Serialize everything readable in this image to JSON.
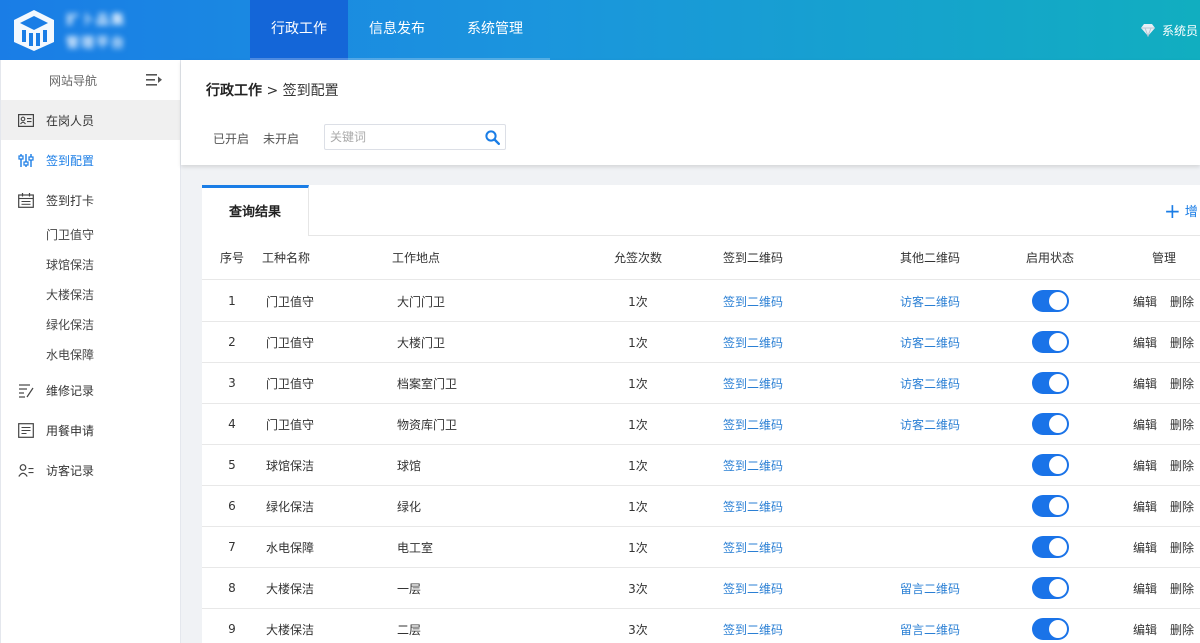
{
  "header": {
    "logo_line1": "扩卜品集",
    "logo_line2": "管理平台",
    "nav": [
      {
        "label": "行政工作",
        "active": true
      },
      {
        "label": "信息发布",
        "active": false
      },
      {
        "label": "系统管理",
        "active": false
      }
    ],
    "user_label": "系统员",
    "colors": {
      "gradient_start": "#1a7de6",
      "gradient_end": "#11aec0",
      "active_nav": "#1466d8"
    }
  },
  "sidebar": {
    "title": "网站导航",
    "items": [
      {
        "label": "在岗人员",
        "icon": "id-card-icon",
        "state": "hover"
      },
      {
        "label": "签到配置",
        "icon": "sliders-icon",
        "state": "active"
      },
      {
        "label": "签到打卡",
        "icon": "calendar-icon",
        "state": "normal"
      }
    ],
    "subitems": [
      "门卫值守",
      "球馆保洁",
      "大楼保洁",
      "绿化保洁",
      "水电保障"
    ],
    "items_after": [
      {
        "label": "维修记录",
        "icon": "edit-list-icon"
      },
      {
        "label": "用餐申请",
        "icon": "form-icon"
      },
      {
        "label": "访客记录",
        "icon": "user-list-icon"
      }
    ]
  },
  "breadcrumb": {
    "parent": "行政工作",
    "separator": ">",
    "current": "签到配置"
  },
  "filters": {
    "enabled": "已开启",
    "disabled": "未开启",
    "search_placeholder": "关键词",
    "search_value": ""
  },
  "results": {
    "tab_label": "查询结果",
    "add_label": "增",
    "columns": [
      "序号",
      "工种名称",
      "工作地点",
      "允签次数",
      "签到二维码",
      "其他二维码",
      "启用状态",
      "管理"
    ],
    "rows": [
      {
        "idx": "1",
        "name": "门卫值守",
        "location": "大门门卫",
        "count": "1次",
        "qr": "签到二维码",
        "other_qr": "访客二维码",
        "enabled": true
      },
      {
        "idx": "2",
        "name": "门卫值守",
        "location": "大楼门卫",
        "count": "1次",
        "qr": "签到二维码",
        "other_qr": "访客二维码",
        "enabled": true
      },
      {
        "idx": "3",
        "name": "门卫值守",
        "location": "档案室门卫",
        "count": "1次",
        "qr": "签到二维码",
        "other_qr": "访客二维码",
        "enabled": true
      },
      {
        "idx": "4",
        "name": "门卫值守",
        "location": "物资库门卫",
        "count": "1次",
        "qr": "签到二维码",
        "other_qr": "访客二维码",
        "enabled": true
      },
      {
        "idx": "5",
        "name": "球馆保洁",
        "location": "球馆",
        "count": "1次",
        "qr": "签到二维码",
        "other_qr": "",
        "enabled": true
      },
      {
        "idx": "6",
        "name": "绿化保洁",
        "location": "绿化",
        "count": "1次",
        "qr": "签到二维码",
        "other_qr": "",
        "enabled": true
      },
      {
        "idx": "7",
        "name": "水电保障",
        "location": "电工室",
        "count": "1次",
        "qr": "签到二维码",
        "other_qr": "",
        "enabled": true
      },
      {
        "idx": "8",
        "name": "大楼保洁",
        "location": "一层",
        "count": "3次",
        "qr": "签到二维码",
        "other_qr": "留言二维码",
        "enabled": true
      },
      {
        "idx": "9",
        "name": "大楼保洁",
        "location": "二层",
        "count": "3次",
        "qr": "签到二维码",
        "other_qr": "留言二维码",
        "enabled": true
      }
    ],
    "actions": {
      "edit": "编辑",
      "delete": "删除"
    },
    "toggle_color": "#1a73e8",
    "link_color": "#2a7fd4"
  }
}
